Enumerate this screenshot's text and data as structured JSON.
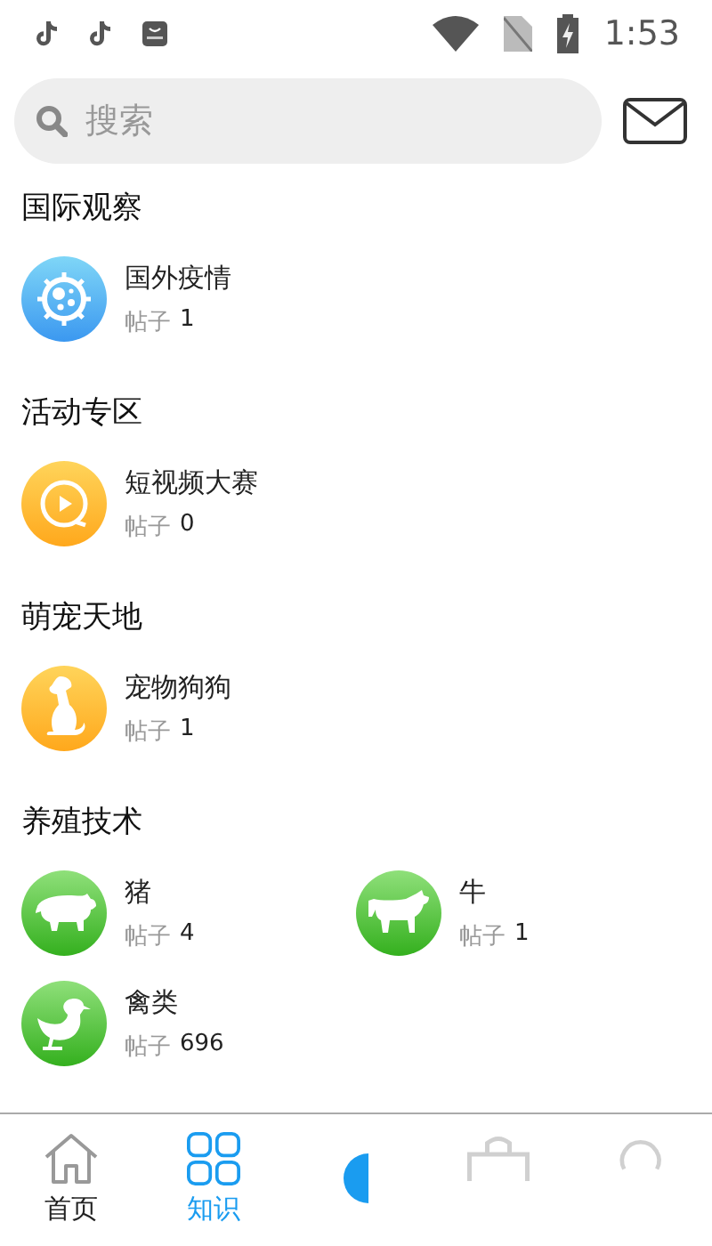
{
  "status_bar": {
    "time": "1:53"
  },
  "search": {
    "placeholder": "搜索"
  },
  "sections": [
    {
      "title": "国际观察",
      "items": [
        {
          "name": "国外疫情",
          "count_label": "帖子",
          "count": "1",
          "kind": "virus"
        }
      ]
    },
    {
      "title": "活动专区",
      "items": [
        {
          "name": "短视频大赛",
          "count_label": "帖子",
          "count": "0",
          "kind": "video"
        }
      ]
    },
    {
      "title": "萌宠天地",
      "items": [
        {
          "name": "宠物狗狗",
          "count_label": "帖子",
          "count": "1",
          "kind": "dog"
        }
      ]
    },
    {
      "title": "养殖技术",
      "items": [
        {
          "name": "猪",
          "count_label": "帖子",
          "count": "4",
          "kind": "pig"
        },
        {
          "name": "牛",
          "count_label": "帖子",
          "count": "1",
          "kind": "cow"
        },
        {
          "name": "禽类",
          "count_label": "帖子",
          "count": "696",
          "kind": "goose"
        }
      ]
    }
  ],
  "bottom_nav": [
    {
      "label": "首页",
      "kind": "home",
      "selected": false
    },
    {
      "label": "知识",
      "kind": "grid",
      "selected": true
    },
    {
      "kind": "center",
      "selected": false
    },
    {
      "kind": "bag",
      "selected": false
    },
    {
      "kind": "profile",
      "selected": false
    }
  ]
}
